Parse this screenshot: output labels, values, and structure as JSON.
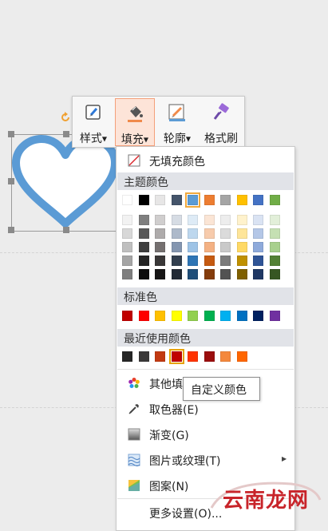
{
  "toolbar": {
    "style_label": "样式",
    "fill_label": "填充",
    "outline_label": "轮廓",
    "format_painter_label": "格式刷"
  },
  "fill_menu": {
    "no_fill": "无填充颜色",
    "theme_colors_header": "主题颜色",
    "theme_colors_top": [
      "#ffffff",
      "#000000",
      "#e7e6e6",
      "#44546a",
      "#5b9bd5",
      "#ed7d31",
      "#a5a5a5",
      "#ffc000",
      "#4472c4",
      "#70ad47"
    ],
    "theme_colors_shades": [
      [
        "#f2f2f2",
        "#7f7f7f",
        "#d0cece",
        "#d6dce4",
        "#deebf6",
        "#fbe5d5",
        "#ededed",
        "#fff2cc",
        "#dae3f3",
        "#e2efd9"
      ],
      [
        "#d8d8d8",
        "#595959",
        "#aeabab",
        "#adb9ca",
        "#bdd7ee",
        "#f7cbac",
        "#dbdbdb",
        "#fee599",
        "#b4c7e7",
        "#c5e0b3"
      ],
      [
        "#bfbfbf",
        "#3f3f3f",
        "#757070",
        "#8496b0",
        "#9dc3e6",
        "#f4b183",
        "#c9c9c9",
        "#ffd965",
        "#8eaadb",
        "#a8d08d"
      ],
      [
        "#a5a5a5",
        "#262626",
        "#3a3838",
        "#323f4f",
        "#2e75b5",
        "#c55a11",
        "#7b7b7b",
        "#bf9000",
        "#2f5496",
        "#538135"
      ],
      [
        "#7f7f7f",
        "#0c0c0c",
        "#171616",
        "#222a35",
        "#1f4e79",
        "#843c0b",
        "#525252",
        "#7f6000",
        "#1f3864",
        "#375623"
      ]
    ],
    "standard_colors_header": "标准色",
    "standard_colors": [
      "#c00000",
      "#ff0000",
      "#ffc000",
      "#ffff00",
      "#92d050",
      "#00b050",
      "#00b0f0",
      "#0070c0",
      "#002060",
      "#7030a0"
    ],
    "recent_colors_header": "最近使用颜色",
    "recent_colors": [
      "#262626",
      "#3a3838",
      "#c23a12",
      "#c00000",
      "#ff3300",
      "#9b0e0e",
      "#f4883c",
      "#ff6600"
    ],
    "more_fill_colors": "其他填",
    "eyedropper": "取色器(E)",
    "gradient": "渐变(G)",
    "picture_texture": "图片或纹理(T)",
    "pattern": "图案(N)",
    "more_settings": "更多设置(O)..."
  },
  "tooltip": "自定义颜色",
  "watermark": "云南龙网",
  "colors": {
    "heart_stroke": "#5b9bd5",
    "active_button_bg": "#fde4d8",
    "active_button_border": "#f4a07a",
    "section_bg": "#e1e3e8",
    "selected_swatch_outline": "#f0a93e"
  }
}
